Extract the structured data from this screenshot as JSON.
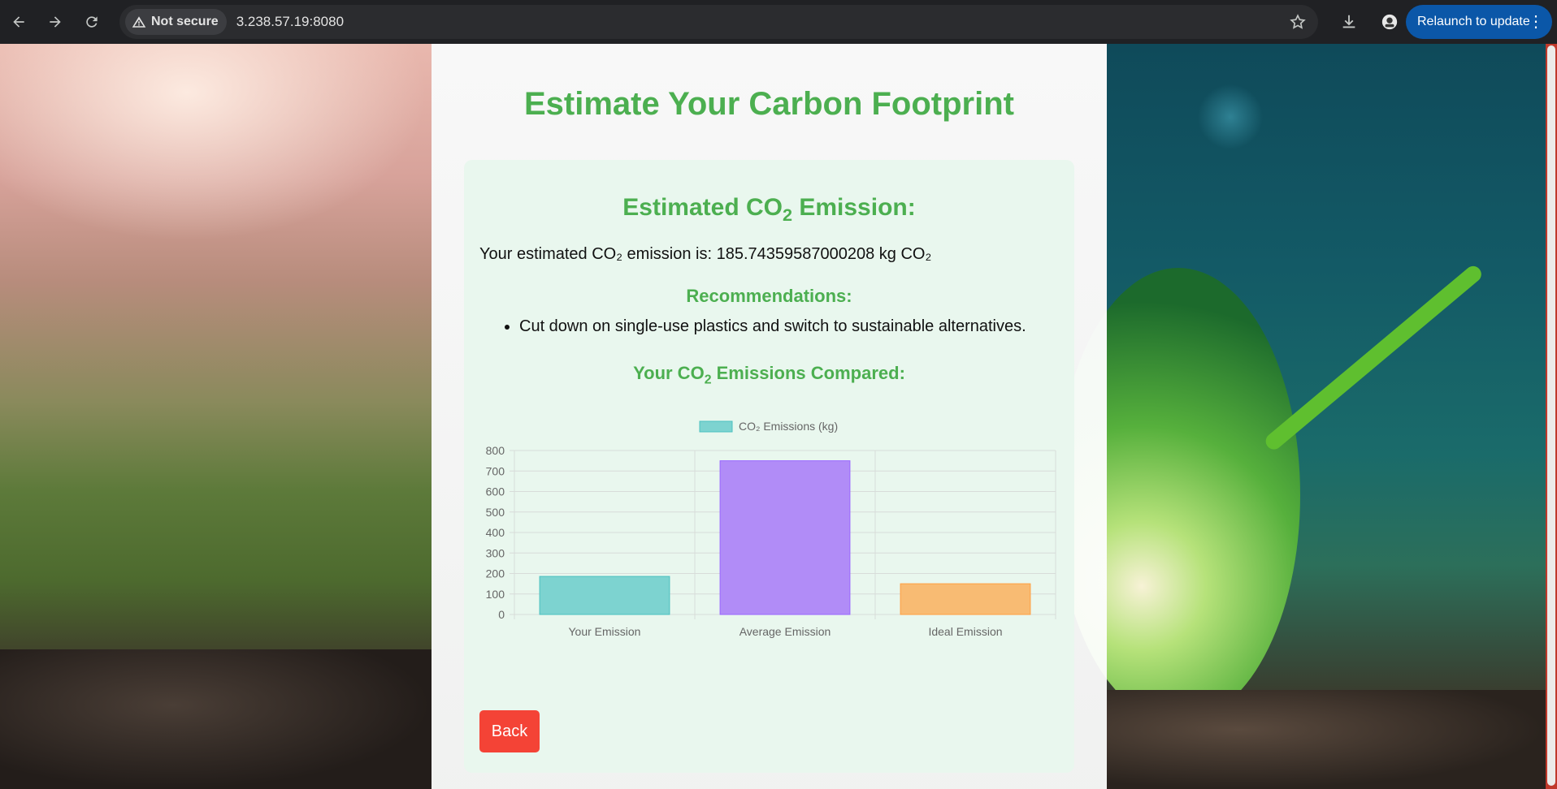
{
  "browser": {
    "security_label": "Not secure",
    "url": "3.238.57.19:8080",
    "relaunch_label": "Relaunch to update",
    "relaunch_dots": "⋮"
  },
  "page": {
    "title": "Estimate Your Carbon Footprint",
    "emission_heading_main": "Estimated CO",
    "emission_heading_sub": "2",
    "emission_heading_end": " Emission:",
    "result_text": "Your estimated CO₂ emission is: 185.74359587000208 kg CO₂",
    "recommendations_heading": "Recommendations:",
    "recommendations": [
      "Cut down on single-use plastics and switch to sustainable alternatives."
    ],
    "compare_heading_main": "Your CO",
    "compare_heading_sub": "2",
    "compare_heading_end": " Emissions Compared:",
    "back_label": "Back"
  },
  "colors": {
    "accent_green": "#4caf50",
    "back_button": "#f44336",
    "bar_teal": "#7dd3d0",
    "bar_purple": "#b18cf7",
    "bar_orange": "#f8bb73"
  },
  "chart_data": {
    "type": "bar",
    "categories": [
      "Your Emission",
      "Average Emission",
      "Ideal Emission"
    ],
    "series": [
      {
        "name": "CO₂ Emissions (kg)",
        "values": [
          185.74359587000208,
          750,
          150
        ],
        "colors": [
          "#7dd3d0",
          "#b18cf7",
          "#f8bb73"
        ],
        "borders": [
          "#4bc0c0",
          "#9966ff",
          "#ff9f40"
        ]
      }
    ],
    "ylim": [
      0,
      800
    ],
    "yticks": [
      0,
      100,
      200,
      300,
      400,
      500,
      600,
      700,
      800
    ],
    "grid": true,
    "legend_position": "top"
  }
}
